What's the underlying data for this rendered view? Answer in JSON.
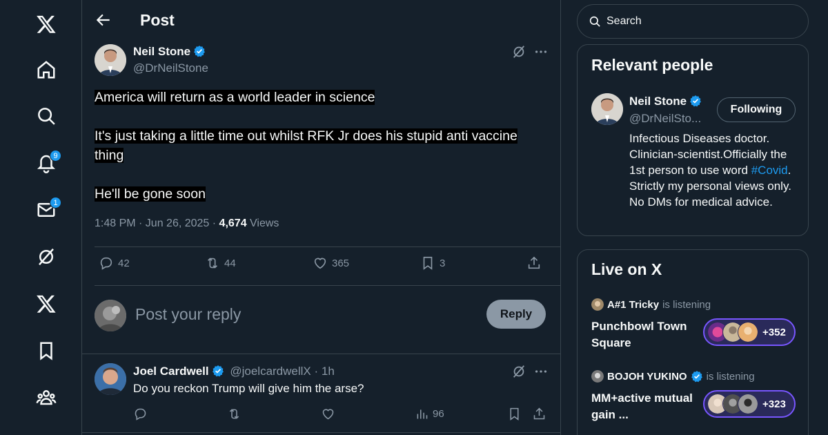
{
  "nav": {
    "items": [
      {
        "icon": "x-logo-icon"
      },
      {
        "icon": "home-icon"
      },
      {
        "icon": "search-icon"
      },
      {
        "icon": "bell-icon",
        "badge": "9"
      },
      {
        "icon": "mail-icon",
        "badge": "1"
      },
      {
        "icon": "grok-icon"
      },
      {
        "icon": "x-premium-icon"
      },
      {
        "icon": "bookmark-icon"
      },
      {
        "icon": "communities-icon"
      }
    ]
  },
  "header": {
    "title": "Post"
  },
  "post": {
    "author_name": "Neil Stone",
    "author_handle": "@DrNeilStone",
    "paragraphs": [
      "America will return as a world leader in science",
      "It's just taking a little time out whilst RFK Jr does his stupid anti vaccine thing",
      "He'll be gone soon"
    ],
    "time": "1:48 PM · Jun 26, 2025 · ",
    "views_count": "4,674",
    "views_label": " Views",
    "stats": {
      "replies": "42",
      "reposts": "44",
      "likes": "365",
      "bookmarks": "3"
    }
  },
  "reply_box": {
    "placeholder": "Post your reply",
    "button": "Reply"
  },
  "reply_tweet": {
    "name": "Joel Cardwell",
    "handle": "@joelcardwellX · 1h",
    "text": "Do you reckon Trump will give him the arse?",
    "views": "96"
  },
  "search": {
    "placeholder": "Search"
  },
  "relevant_people": {
    "title": "Relevant people",
    "name": "Neil Stone",
    "handle": "@DrNeilSto...",
    "button": "Following",
    "bio_1": "Infectious Diseases doctor. Clinician-scientist.Officially the 1st person to use word ",
    "bio_hashtag": "#Covid",
    "bio_2": ". Strictly my personal views only. No DMs for medical advice."
  },
  "live": {
    "title": "Live on X",
    "spaces": [
      {
        "user": "A#1 Tricky",
        "status": "is listening",
        "title": "Punchbowl Town Square",
        "count": "+352"
      },
      {
        "user": "BOJOH YUKINO",
        "status": "is listening",
        "title": "MM+active mutual gain ...",
        "count": "+323"
      }
    ]
  },
  "colors": {
    "accent": "#1d9bf0",
    "background": "#15202b",
    "border": "#38444d",
    "muted": "#8b98a5",
    "space_border": "#7856ff"
  }
}
